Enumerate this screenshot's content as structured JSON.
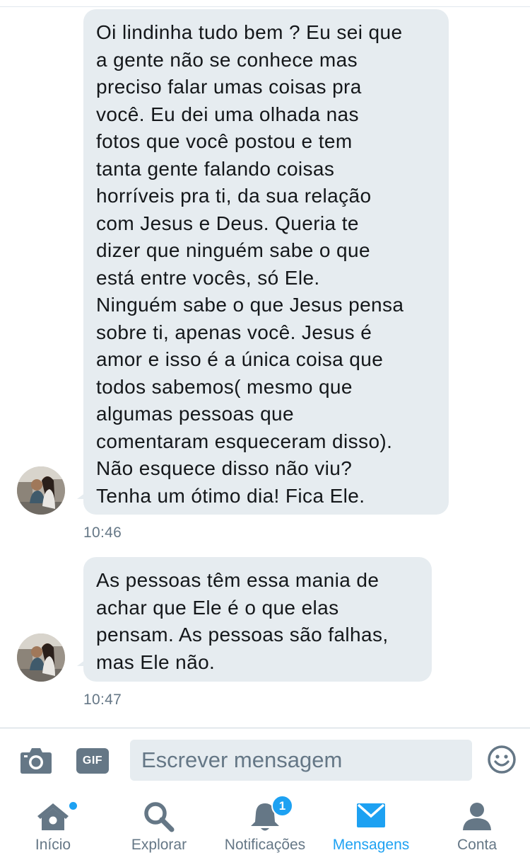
{
  "conversation": {
    "messages": [
      {
        "text": "Oi lindinha tudo bem ? Eu sei que\na gente não se conhece mas\npreciso falar umas coisas pra\nvocê. Eu dei uma olhada nas\nfotos que você postou e tem\ntanta gente falando coisas\nhorríveis pra ti, da sua relação\ncom Jesus e Deus. Queria te\ndizer que ninguém sabe o que\nestá entre vocês, só Ele.\nNinguém sabe o que Jesus pensa\nsobre ti, apenas você. Jesus é\namor e isso é a única coisa que\ntodos sabemos( mesmo que\nalgumas pessoas que\ncomentaram esqueceram disso).\nNão esquece disso não viu?\nTenha um ótimo dia! Fica Ele.",
        "time": "10:46"
      },
      {
        "text": "As pessoas têm essa mania de\nachar que Ele é o que elas\npensam. As pessoas são falhas,\nmas Ele não.",
        "time": "10:47"
      }
    ]
  },
  "composer": {
    "camera_icon": "camera-icon",
    "gif_label": "GIF",
    "placeholder": "Escrever mensagem",
    "emoji_icon": "emoji-icon"
  },
  "tabbar": {
    "tabs": [
      {
        "label": "Início",
        "icon": "home-icon",
        "has_dot": true
      },
      {
        "label": "Explorar",
        "icon": "search-icon"
      },
      {
        "label": "Notificações",
        "icon": "bell-icon",
        "badge": "1"
      },
      {
        "label": "Mensagens",
        "icon": "mail-icon",
        "active": true
      },
      {
        "label": "Conta",
        "icon": "person-icon"
      }
    ]
  },
  "colors": {
    "accent": "#1da1f2",
    "bubble": "#e6ecf0",
    "muted": "#657786",
    "text": "#14171a"
  }
}
